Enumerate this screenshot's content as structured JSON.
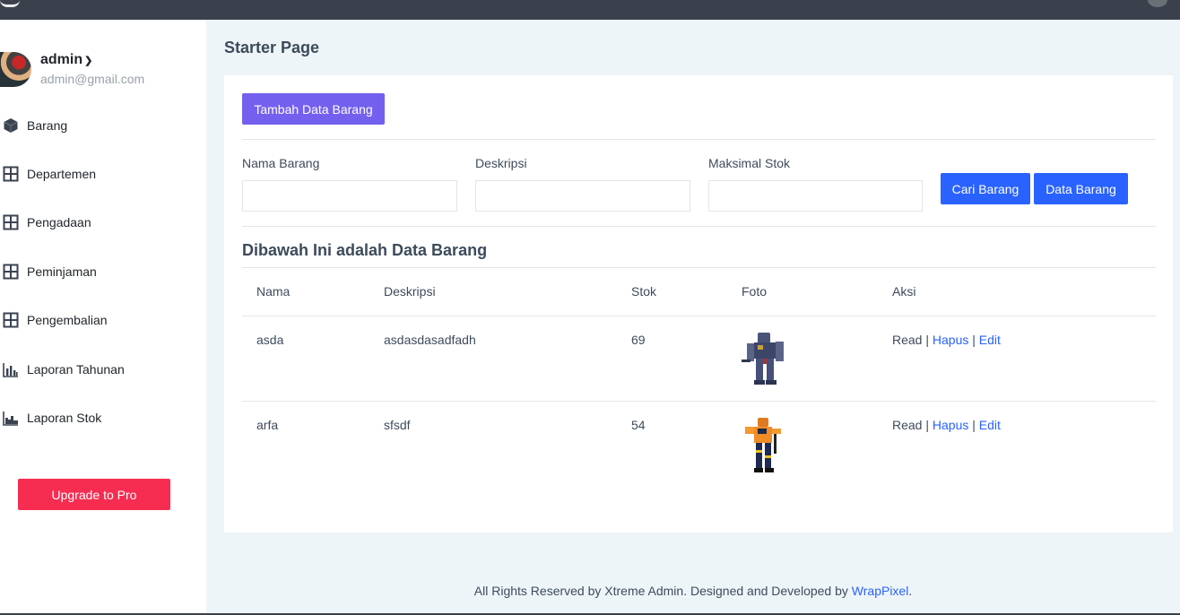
{
  "user": {
    "name": "admin",
    "email": "admin@gmail.com"
  },
  "nav": [
    {
      "label": "Barang",
      "icon": "cube-icon"
    },
    {
      "label": "Departemen",
      "icon": "grid-icon"
    },
    {
      "label": "Pengadaan",
      "icon": "grid-icon"
    },
    {
      "label": "Peminjaman",
      "icon": "grid-icon"
    },
    {
      "label": "Pengembalian",
      "icon": "grid-icon"
    },
    {
      "label": "Laporan Tahunan",
      "icon": "bar-chart-icon"
    },
    {
      "label": "Laporan Stok",
      "icon": "area-chart-icon"
    }
  ],
  "upgrade_label": "Upgrade to Pro",
  "page_title": "Starter Page",
  "add_button": "Tambah Data Barang",
  "form": {
    "nama_label": "Nama Barang",
    "nama_value": "",
    "deskripsi_label": "Deskripsi",
    "deskripsi_value": "",
    "stok_label": "Maksimal Stok",
    "stok_value": "",
    "search_button": "Cari Barang",
    "data_button": "Data Barang"
  },
  "section_title": "Dibawah Ini adalah Data Barang",
  "table": {
    "headers": [
      "Nama",
      "Deskripsi",
      "Stok",
      "Foto",
      "Aksi"
    ],
    "rows": [
      {
        "nama": "asda",
        "deskripsi": "asdasdasadfadh",
        "stok": "69",
        "read": "Read",
        "hapus": "Hapus",
        "edit": "Edit"
      },
      {
        "nama": "arfa",
        "deskripsi": "sfsdf",
        "stok": "54",
        "read": "Read",
        "hapus": "Hapus",
        "edit": "Edit"
      }
    ],
    "separator": "|"
  },
  "footer": {
    "text": "All Rights Reserved by Xtreme Admin. Designed and Developed by ",
    "link": "WrapPixel",
    "end": "."
  },
  "colors": {
    "accent_blue": "#2962ff",
    "purple": "#7460ee",
    "upgrade_red": "#f62d51",
    "topbar": "#3b414c"
  }
}
